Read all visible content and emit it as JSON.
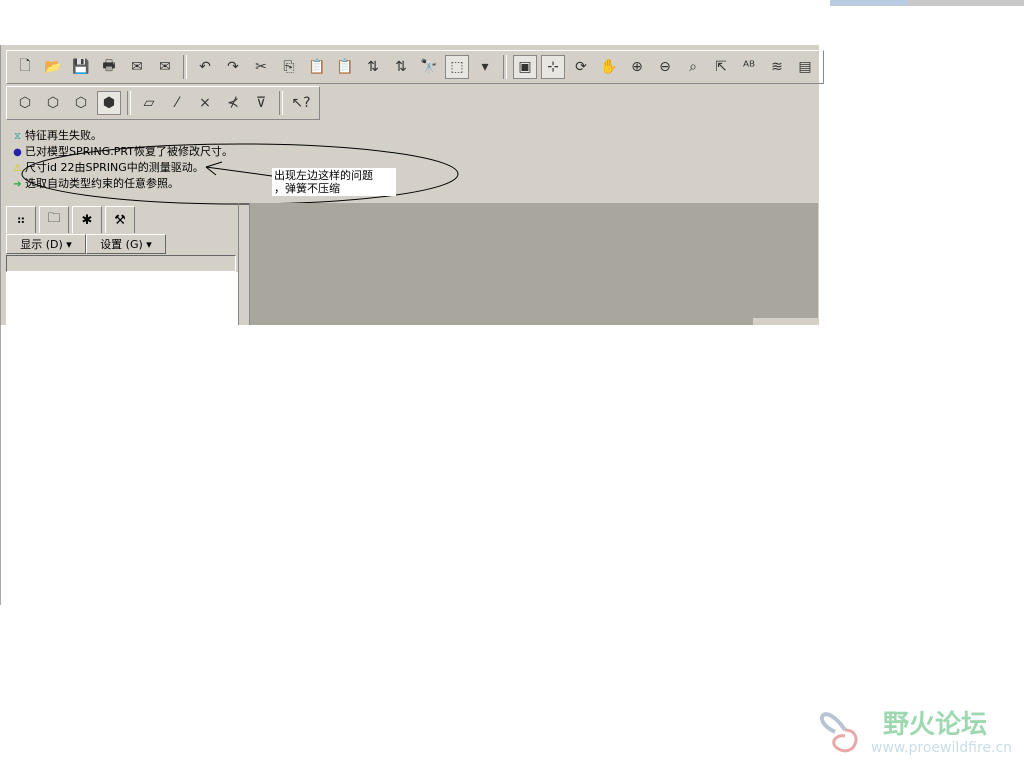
{
  "toolbar1": [
    [
      "new-file-icon",
      "🗋"
    ],
    [
      "open-folder-icon",
      "📂"
    ],
    [
      "save-icon",
      "💾"
    ],
    [
      "print-icon",
      "🖶"
    ],
    [
      "send-mail-icon",
      "✉"
    ],
    [
      "mail-attach-icon",
      "✉"
    ],
    null,
    [
      "undo-icon",
      "↶"
    ],
    [
      "redo-icon",
      "↷"
    ],
    [
      "cut-icon",
      "✂"
    ],
    [
      "copy-icon",
      "⎘"
    ],
    [
      "paste-icon",
      "📋"
    ],
    [
      "paste-special-icon",
      "📋"
    ],
    [
      "regenerate-icon",
      "⇅"
    ],
    [
      "regen-manager-icon",
      "⇅"
    ],
    [
      "find-icon",
      "🔭"
    ],
    [
      "selection-box-icon",
      "⬚"
    ],
    [
      "dropdown-arrow-icon",
      "▾"
    ],
    null,
    [
      "repaint-icon",
      "▣"
    ],
    [
      "spin-center-icon",
      "⊹"
    ],
    [
      "orient-mode-icon",
      "⟳"
    ],
    [
      "pan-hand-icon",
      "✋"
    ],
    [
      "zoom-in-icon",
      "⊕"
    ],
    [
      "zoom-out-icon",
      "⊖"
    ],
    [
      "refit-icon",
      "⌕"
    ],
    [
      "reorient-icon",
      "⇱"
    ],
    [
      "saved-views-icon",
      "ᴬᴮ"
    ],
    [
      "layers-icon",
      "≋"
    ],
    [
      "view-manager-icon",
      "▤"
    ]
  ],
  "toolbar2": [
    [
      "wireframe-icon",
      "⬡"
    ],
    [
      "hidden-line-icon",
      "⬡"
    ],
    [
      "no-hidden-icon",
      "⬡"
    ],
    [
      "shading-icon",
      "⬢"
    ],
    null,
    [
      "datum-planes-icon",
      "▱"
    ],
    [
      "datum-axes-icon",
      "⁄"
    ],
    [
      "datum-points-icon",
      "×"
    ],
    [
      "coordinate-systems-icon",
      "⊀"
    ],
    [
      "annotations-icon",
      "⊽"
    ],
    null,
    [
      "context-help-icon",
      "↖?"
    ]
  ],
  "messages": [
    {
      "icon": "regen-fail-icon",
      "glyph": "⧖",
      "color": "#2a9",
      "text": "特征再生失败。"
    },
    {
      "icon": "info-bullet-icon",
      "glyph": "●",
      "color": "#22a",
      "text": "已对模型SPRING.PRT恢复了被修改尺寸。"
    },
    {
      "icon": "warning-icon",
      "glyph": "⚠",
      "color": "#cc0",
      "text": "尺寸id 22由SPRING中的测量驱动。"
    },
    {
      "icon": "prompt-arrow-icon",
      "glyph": "➔",
      "color": "#2a4",
      "text": "选取自动类型约束的任意参照。"
    }
  ],
  "annotation": {
    "line1": "出现左边这样的问题",
    "line2": "，弹簧不压缩"
  },
  "navigator": {
    "tabs": [
      [
        "model-tree-tab",
        "⠶"
      ],
      [
        "folder-browser-tab",
        "🗀"
      ],
      [
        "favorites-tab",
        "✱"
      ],
      [
        "connections-tab",
        "⚒"
      ]
    ],
    "show_label": "显示 (D) ▾",
    "settings_label": "设置 (G) ▾"
  },
  "watermark": {
    "name": "野火论坛",
    "url": "www.proewildfire.cn"
  }
}
